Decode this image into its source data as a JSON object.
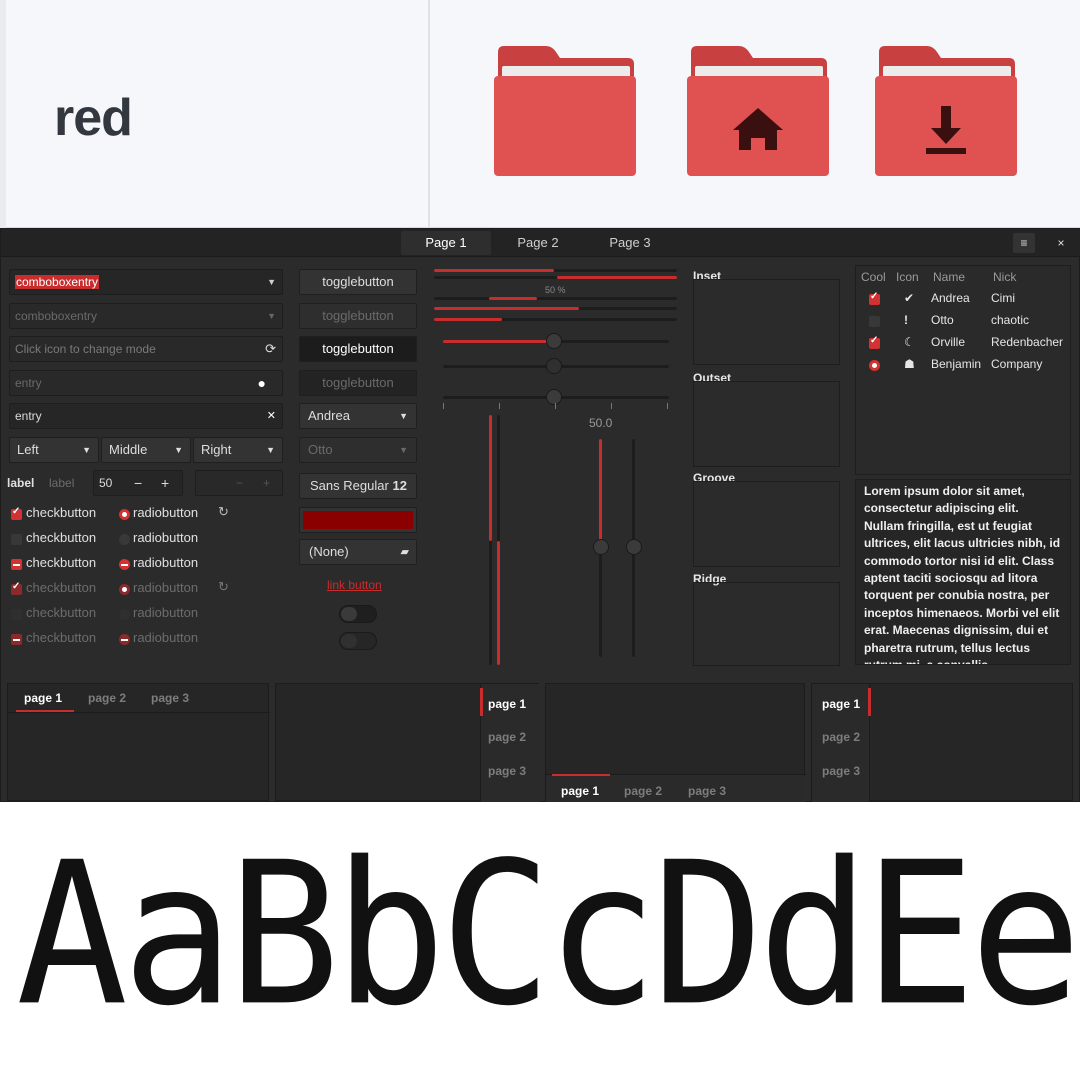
{
  "theme": {
    "name": "red",
    "accent": "#d33232"
  },
  "folders": [
    {
      "icon": "folder-icon"
    },
    {
      "icon": "folder-home-icon"
    },
    {
      "icon": "folder-download-icon"
    }
  ],
  "window": {
    "tabs": [
      "Page 1",
      "Page 2",
      "Page 3"
    ],
    "menu_icon": "≡",
    "close_icon": "×"
  },
  "col1": {
    "combo_active": "comboboxentry",
    "combo_dim": "comboboxentry",
    "mode_placeholder": "Click icon to change mode",
    "entry_dim": "entry",
    "entry": "entry",
    "combos": [
      "Left",
      "Middle",
      "Right"
    ],
    "label_a": "label",
    "label_b": "label",
    "spin_value": "50",
    "spin_minus": "−",
    "spin_plus": "+",
    "checks": [
      "checkbutton",
      "checkbutton",
      "checkbutton",
      "checkbutton",
      "checkbutton",
      "checkbutton"
    ],
    "radios": [
      "radiobutton",
      "radiobutton",
      "radiobutton",
      "radiobutton",
      "radiobutton",
      "radiobutton"
    ]
  },
  "col2": {
    "toggles": [
      "togglebutton",
      "togglebutton",
      "togglebutton",
      "togglebutton"
    ],
    "combo_andrea": "Andrea",
    "combo_otto": "Otto",
    "font_name": "Sans Regular",
    "font_size": "12",
    "file_none": "(None)",
    "link": "link button"
  },
  "col3": {
    "progress_label": "50 %",
    "scale_value": "50.0"
  },
  "frames": [
    "Inset",
    "Outset",
    "Groove",
    "Ridge"
  ],
  "tree": {
    "headers": [
      "Cool",
      "Icon",
      "Name",
      "Nick"
    ],
    "rows": [
      {
        "name": "Andrea",
        "nick": "Cimi",
        "icon": "✔"
      },
      {
        "name": "Otto",
        "nick": "chaotic",
        "icon": "!"
      },
      {
        "name": "Orville",
        "nick": "Redenbacher",
        "icon": "☾"
      },
      {
        "name": "Benjamin",
        "nick": "Company",
        "icon": "☗"
      }
    ]
  },
  "textview": "Lorem ipsum dolor sit amet, consectetur adipiscing elit. Nullam fringilla, est ut feugiat ultrices, elit lacus ultricies nibh, id commodo tortor nisi id elit. Class aptent taciti sociosqu ad litora torquent per conubia nostra, per inceptos himenaeos. Morbi vel elit erat. Maecenas dignissim, dui et pharetra rutrum, tellus lectus rutrum mi, a convallis",
  "notebooks": {
    "tabs": [
      "page 1",
      "page 2",
      "page 3"
    ]
  },
  "sample_text": "AaBbCcDdEe"
}
